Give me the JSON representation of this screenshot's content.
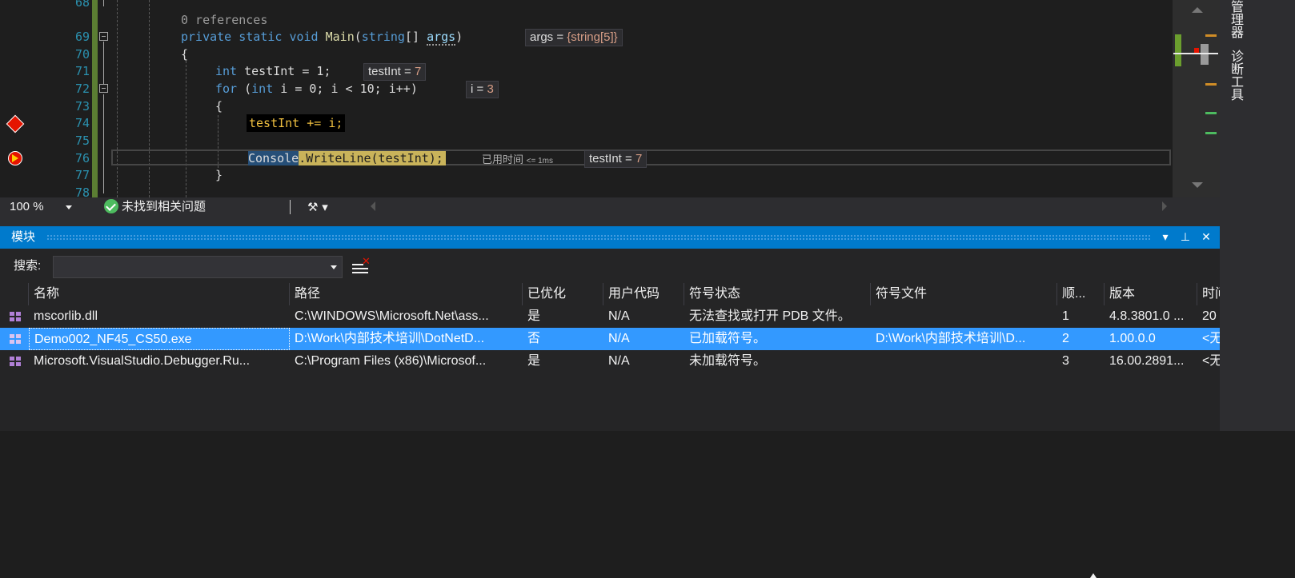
{
  "editor": {
    "lines": [
      {
        "num": "68"
      },
      {
        "num": ""
      },
      {
        "num": "69"
      },
      {
        "num": "70"
      },
      {
        "num": "71"
      },
      {
        "num": "72"
      },
      {
        "num": "73"
      },
      {
        "num": "74"
      },
      {
        "num": "75"
      },
      {
        "num": "76"
      },
      {
        "num": "77"
      },
      {
        "num": "78"
      }
    ],
    "codelens": "0 references",
    "tokens": {
      "private": "private",
      "static": "static",
      "void": "void",
      "main": "Main",
      "string": "string",
      "args": "args",
      "brace_open": "{",
      "brace_close": "}",
      "int": "int",
      "testInt": "testInt",
      "for": "for",
      "i": "i",
      "console": "Console",
      "writeline": "WriteLine"
    },
    "line69_tail": "(",
    "line69_mid": "[] ",
    "line69_end": ")",
    "line71_rest": " = 1;",
    "line72_rest_a": " (",
    "line72_rest_b": " i = 0; i < 10; i++)",
    "line74_code": "testInt += i;",
    "line76_rest": ".WriteLine(testInt);",
    "datatips": {
      "args_name": "args = ",
      "args_value": "{string[5]}",
      "testInt_name": "testInt = ",
      "testInt_value": "7",
      "i_name": "i = ",
      "i_value": "3",
      "testInt2_name": "testInt = ",
      "testInt2_value": "7"
    },
    "elapsed_label": "已用时间",
    "elapsed_value": "<= 1ms",
    "icons": {
      "breakpoint": "breakpoint-icon",
      "instruction_pointer": "current-statement-icon"
    }
  },
  "status": {
    "zoom": "100 %",
    "issues": "未找到相关问题"
  },
  "right_tabs": {
    "tab1": "管理器",
    "tab2": "诊断工具"
  },
  "modules_panel": {
    "title": "模块",
    "buttons": {
      "dropdown": "▾",
      "pin": "⊥",
      "close": "✕"
    },
    "search_label": "搜索:",
    "search_value": "",
    "columns": [
      "名称",
      "路径",
      "已优化",
      "用户代码",
      "符号状态",
      "符号文件",
      "顺...",
      "版本",
      "时间"
    ],
    "rows": [
      {
        "name": "mscorlib.dll",
        "path": "C:\\WINDOWS\\Microsoft.Net\\ass...",
        "optimized": "是",
        "user_code": "N/A",
        "symbol_status": "无法查找或打开 PDB 文件。",
        "symbol_file": "",
        "order": "1",
        "version": "4.8.3801.0 ...",
        "time": "20"
      },
      {
        "name": "Demo002_NF45_CS50.exe",
        "path": "D:\\Work\\内部技术培训\\DotNetD...",
        "optimized": "否",
        "user_code": "N/A",
        "symbol_status": "已加载符号。",
        "symbol_file": "D:\\Work\\内部技术培训\\D...",
        "order": "2",
        "version": "1.00.0.0",
        "time": "<无"
      },
      {
        "name": "Microsoft.VisualStudio.Debugger.Ru...",
        "path": "C:\\Program Files (x86)\\Microsof...",
        "optimized": "是",
        "user_code": "N/A",
        "symbol_status": "未加载符号。",
        "symbol_file": "",
        "order": "3",
        "version": "16.00.2891...",
        "time": "<无"
      }
    ]
  },
  "colors": {
    "editor_bg": "#1e1e1e",
    "panel_title": "#007acc",
    "selection": "#3399ff",
    "keyword": "#569cd6",
    "breakpoint": "#e51400"
  }
}
